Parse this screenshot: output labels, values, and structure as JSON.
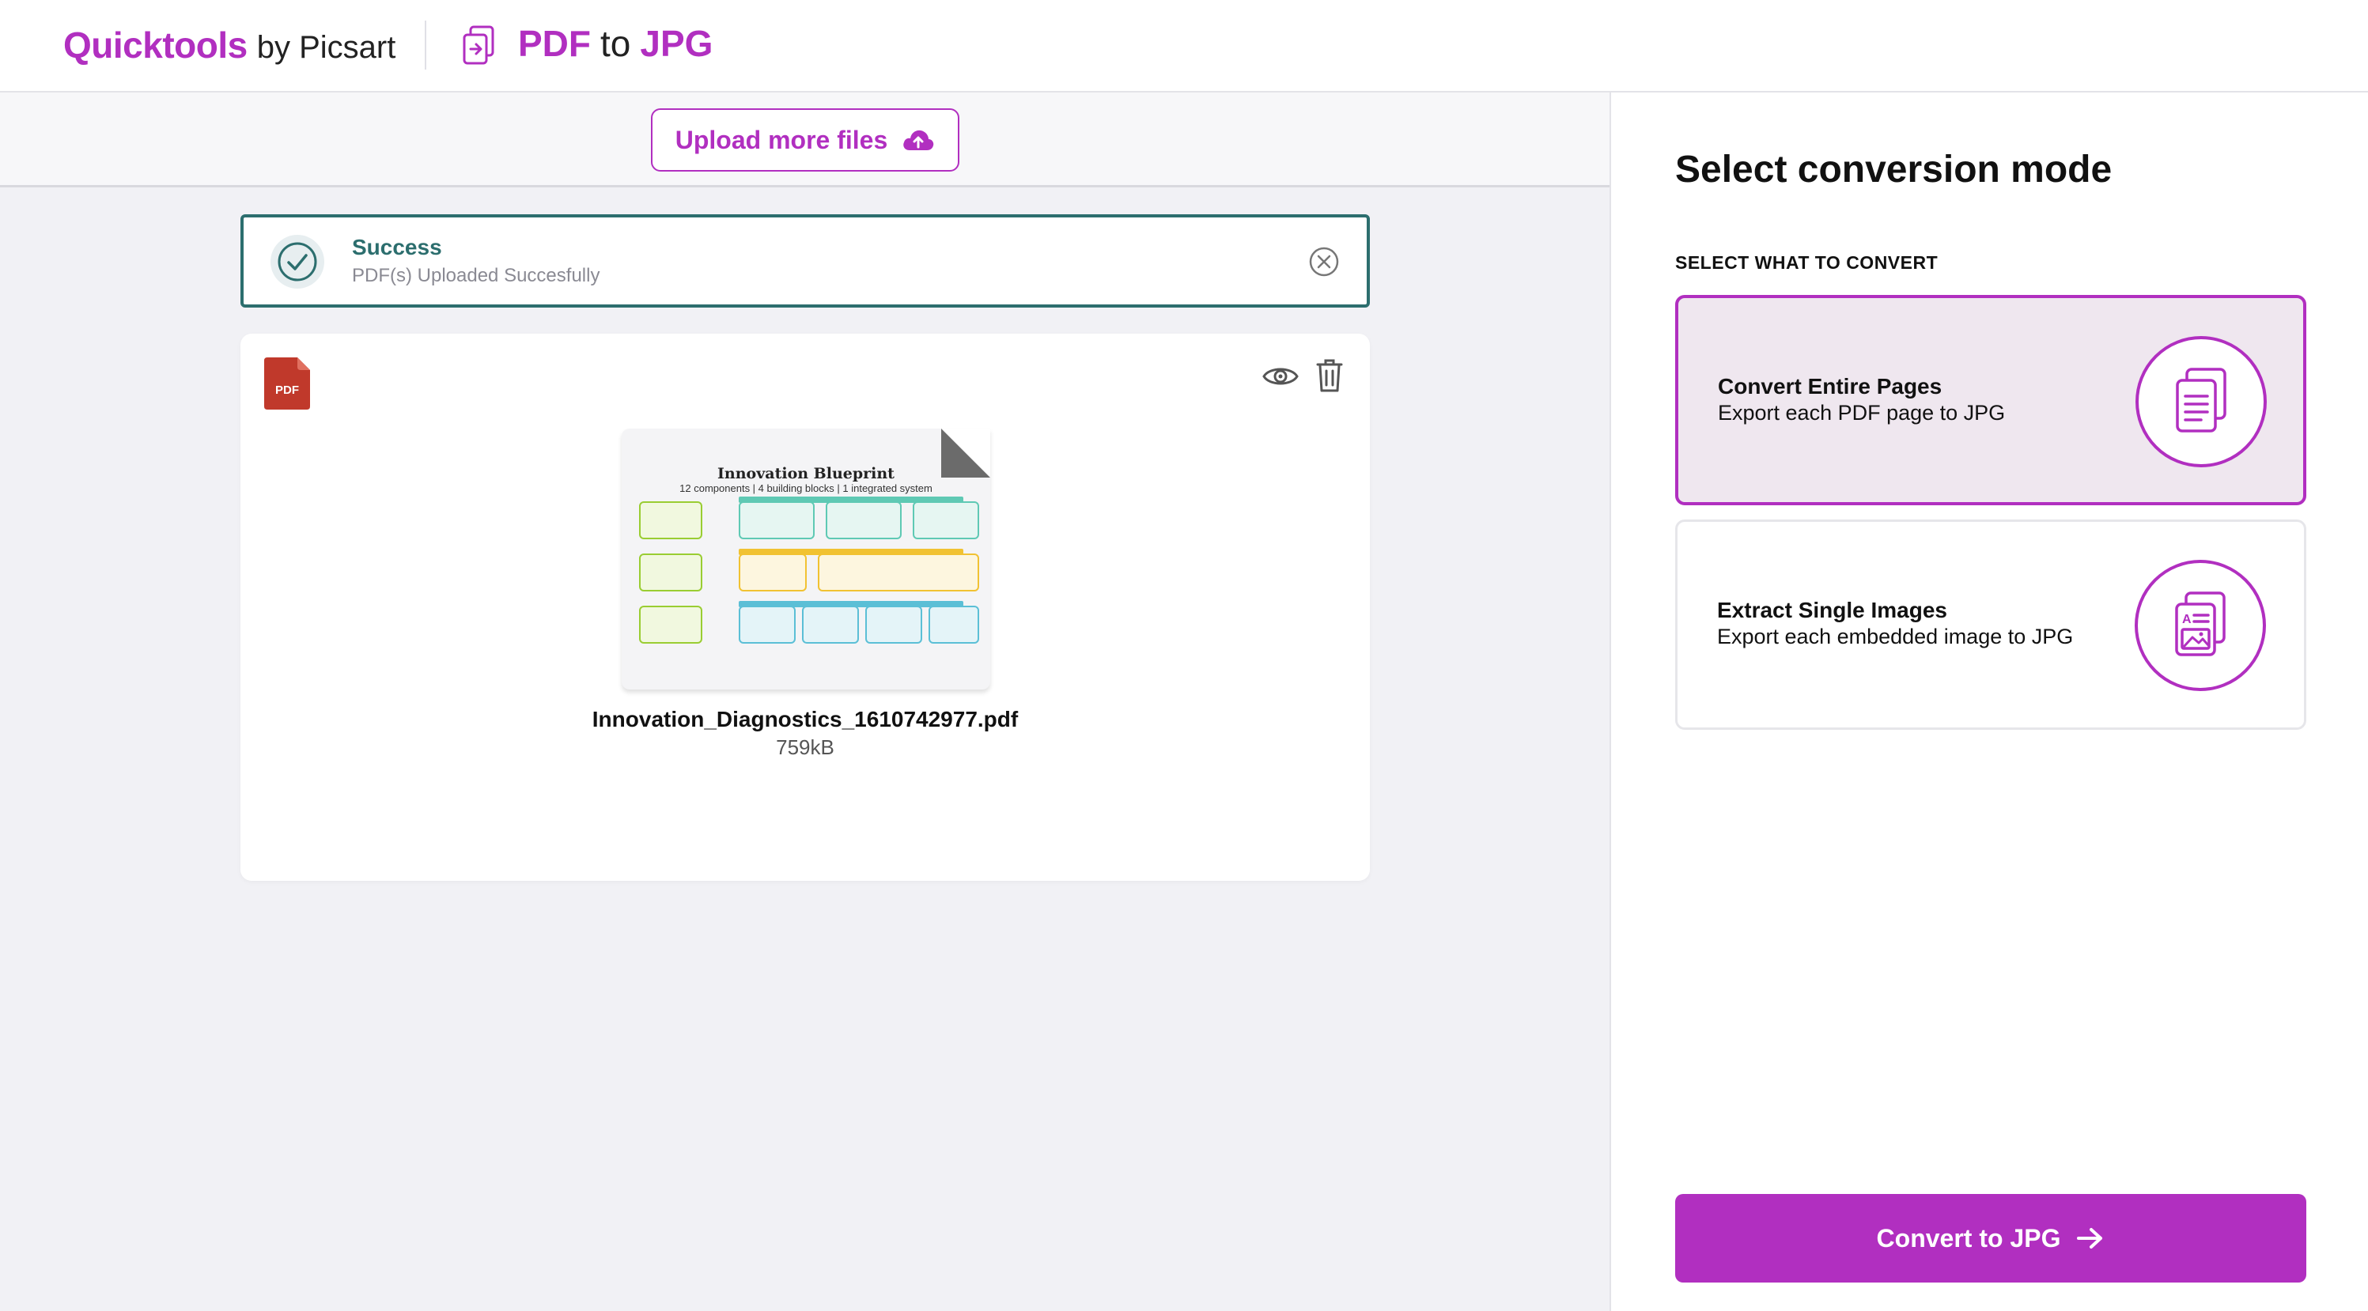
{
  "header": {
    "brand_name": "Quicktools",
    "brand_by": "by Picsart",
    "tool_title_a": "PDF",
    "tool_title_to": "to",
    "tool_title_b": "JPG"
  },
  "upload": {
    "label": "Upload more files"
  },
  "alert": {
    "title": "Success",
    "message": "PDF(s) Uploaded Succesfully"
  },
  "file": {
    "badge": "PDF",
    "name": "Innovation_Diagnostics_1610742977.pdf",
    "size": "759kB",
    "thumbnail_title": "Innovation Blueprint",
    "thumbnail_subtitle": "12 components | 4 building blocks | 1 integrated system"
  },
  "panel": {
    "title": "Select conversion mode",
    "subtitle": "SELECT WHAT TO CONVERT",
    "modes": [
      {
        "title": "Convert Entire Pages",
        "desc": "Export each PDF page to JPG",
        "selected": true
      },
      {
        "title": "Extract Single Images",
        "desc": "Export each embedded image to JPG",
        "selected": false
      }
    ],
    "convert_label": "Convert to JPG"
  },
  "colors": {
    "brand": "#b12fc0",
    "success": "#2c6e6e",
    "background": "#f1f1f5"
  }
}
